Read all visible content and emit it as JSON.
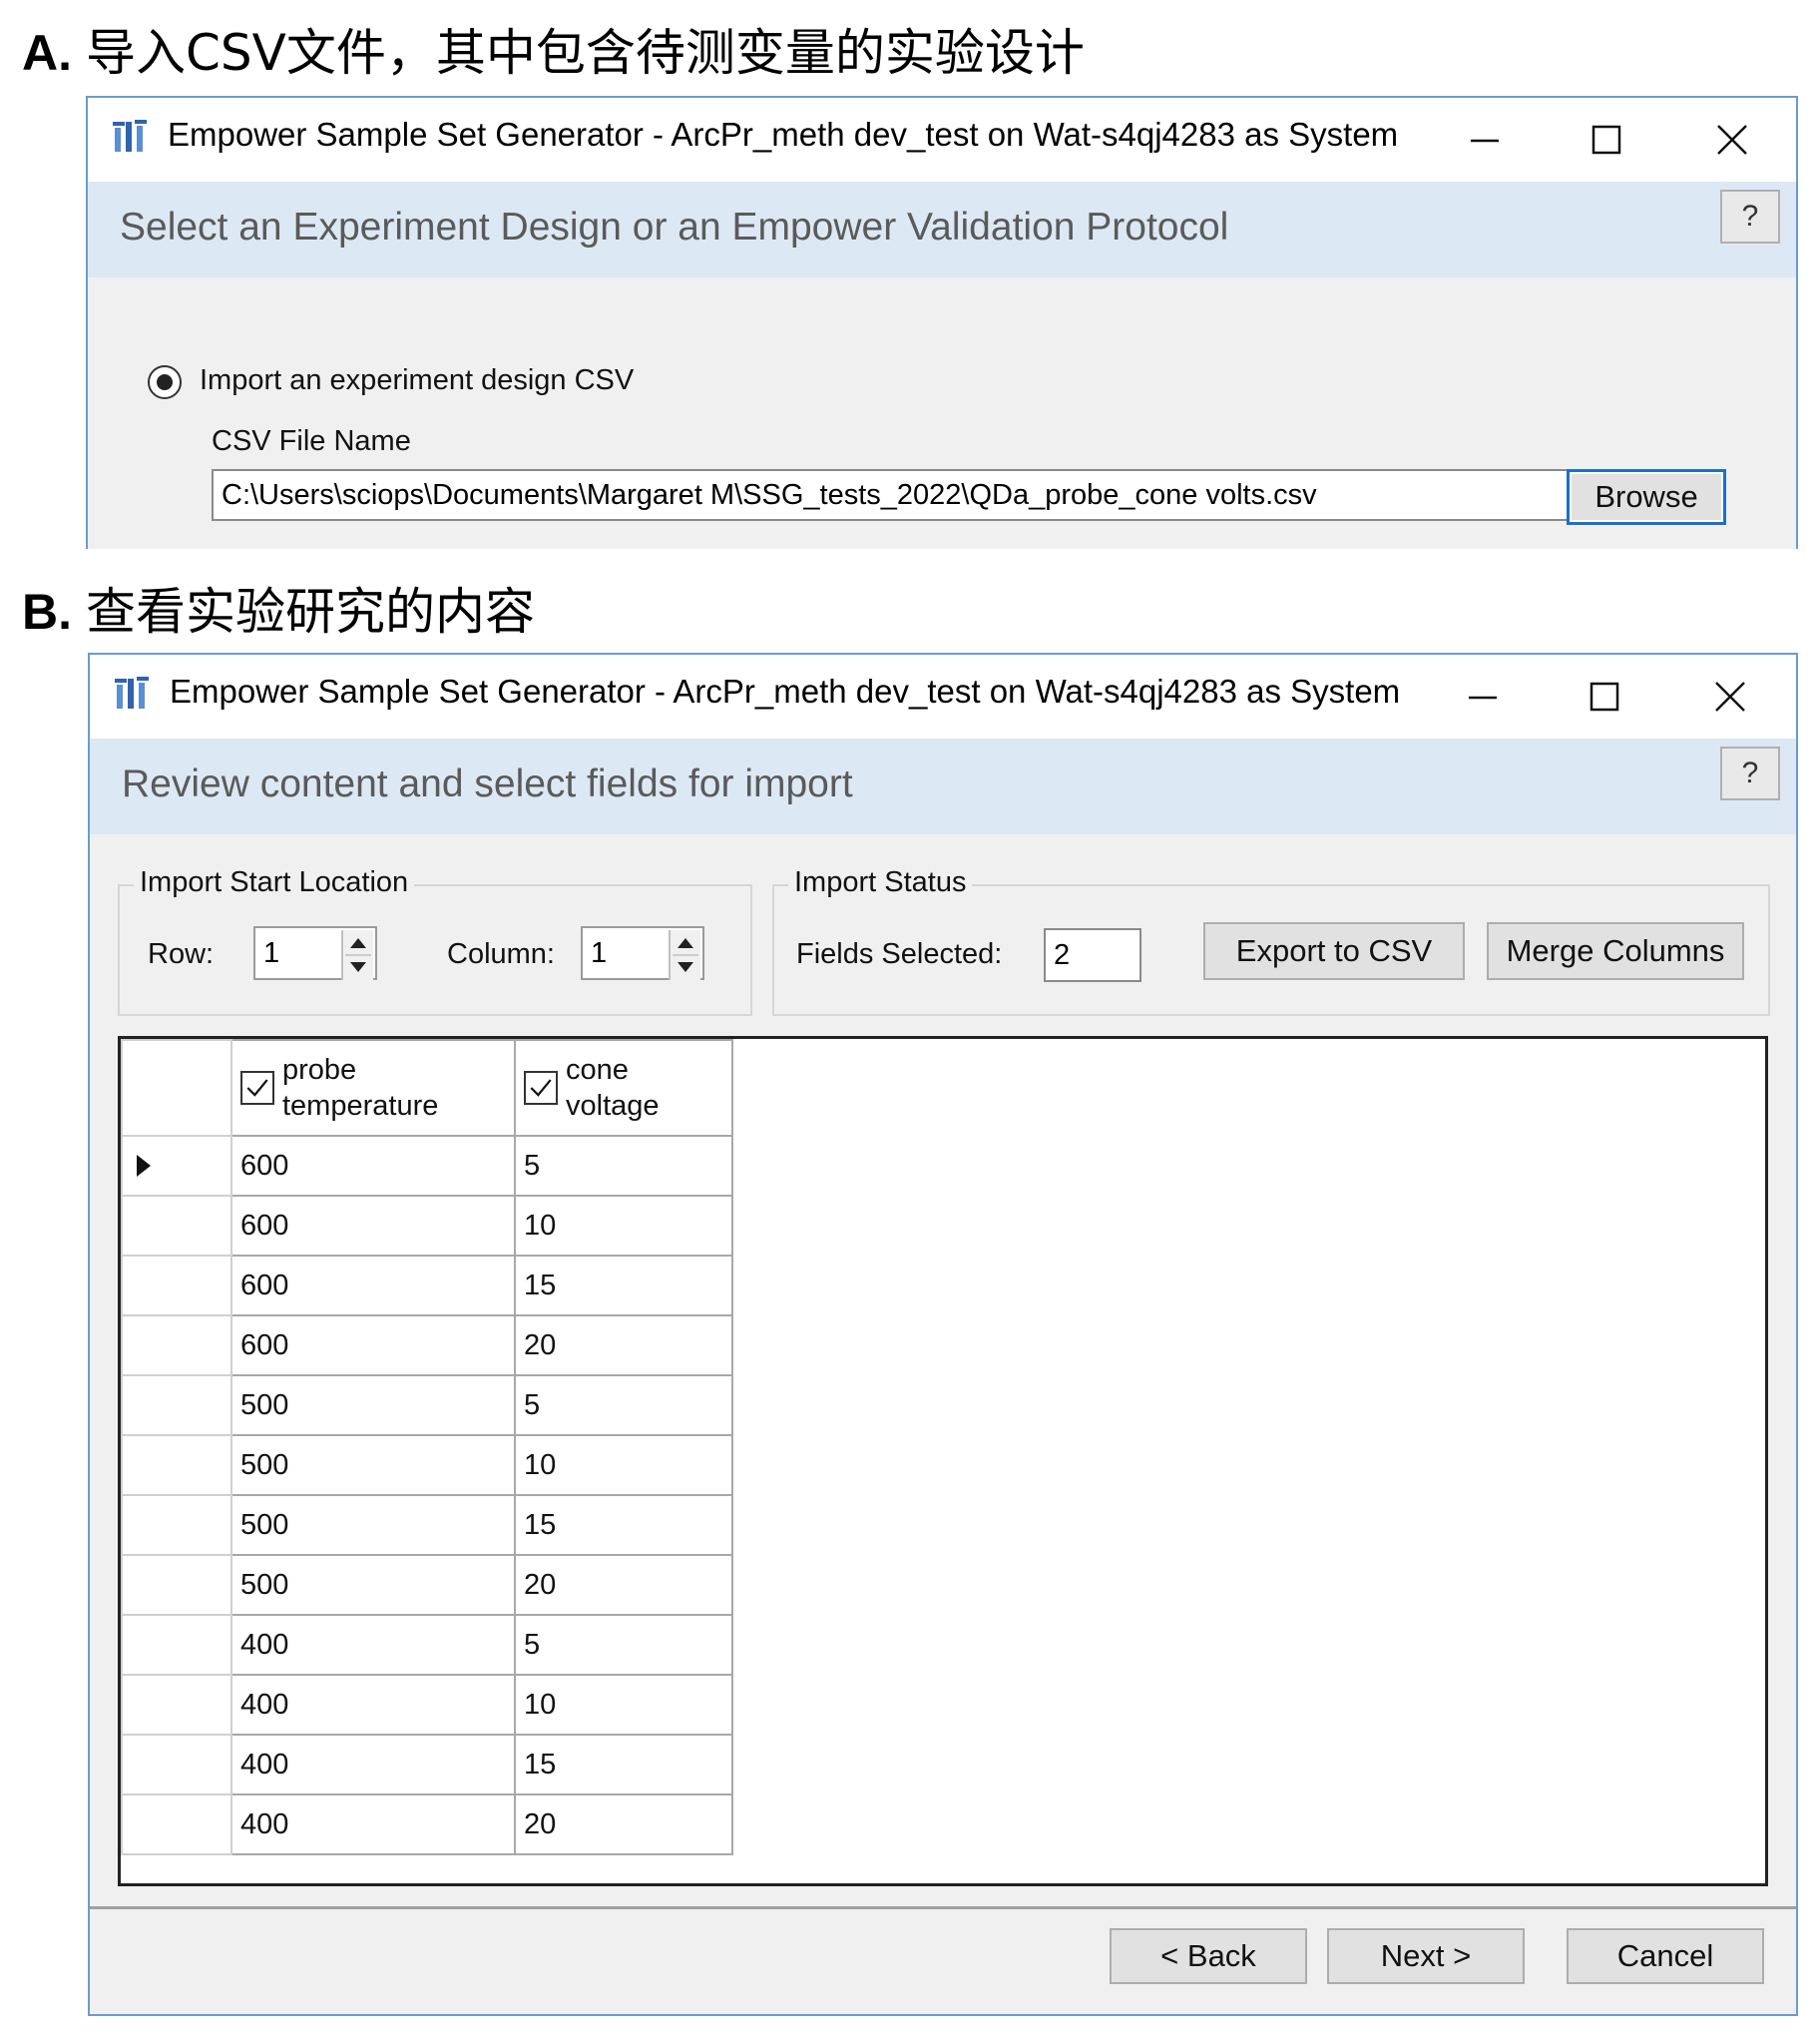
{
  "panel_a": {
    "letter": "A.",
    "caption": "导入CSV文件，其中包含待测变量的实验设计",
    "window_title": "Empower Sample Set Generator - ArcPr_meth dev_test on Wat-s4qj4283 as System",
    "header_title": "Select an Experiment Design or an Empower Validation Protocol",
    "help_label": "?",
    "radio_label": "Import an experiment design CSV",
    "csv_label": "CSV File Name",
    "csv_path": "C:\\Users\\sciops\\Documents\\Margaret M\\SSG_tests_2022\\QDa_probe_cone volts.csv",
    "browse_label": "Browse"
  },
  "panel_b": {
    "letter": "B.",
    "caption": "查看实验研究的内容",
    "window_title": "Empower Sample Set Generator - ArcPr_meth dev_test on Wat-s4qj4283 as System",
    "header_title": "Review content and select fields for import",
    "help_label": "?",
    "import_start": {
      "title": "Import Start Location",
      "row_label": "Row:",
      "row_value": "1",
      "column_label": "Column:",
      "column_value": "1"
    },
    "import_status": {
      "title": "Import Status",
      "fields_label": "Fields Selected:",
      "fields_value": "2",
      "export_label": "Export to CSV",
      "merge_label": "Merge Columns"
    },
    "grid": {
      "columns": [
        {
          "line1": "probe",
          "line2": "temperature",
          "checked": true
        },
        {
          "line1": "cone",
          "line2": "voltage",
          "checked": true
        }
      ],
      "rows": [
        [
          "600",
          "5"
        ],
        [
          "600",
          "10"
        ],
        [
          "600",
          "15"
        ],
        [
          "600",
          "20"
        ],
        [
          "500",
          "5"
        ],
        [
          "500",
          "10"
        ],
        [
          "500",
          "15"
        ],
        [
          "500",
          "20"
        ],
        [
          "400",
          "5"
        ],
        [
          "400",
          "10"
        ],
        [
          "400",
          "15"
        ],
        [
          "400",
          "20"
        ]
      ]
    },
    "nav": {
      "back_label": "< Back",
      "next_label": "Next >",
      "cancel_label": "Cancel"
    }
  }
}
